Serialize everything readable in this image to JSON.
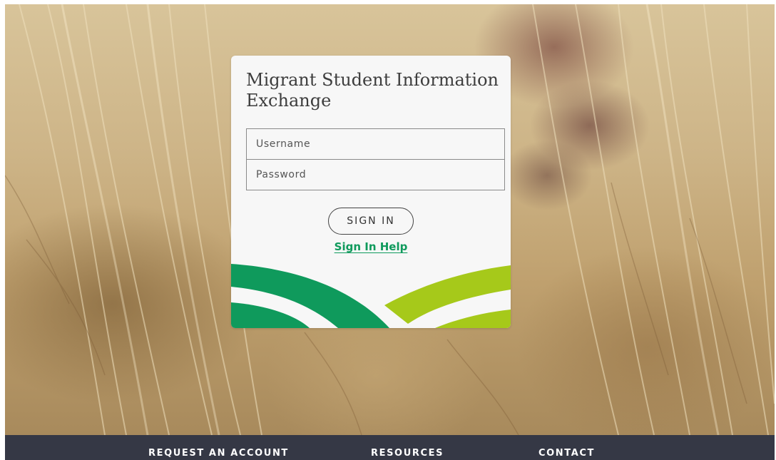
{
  "login": {
    "title": "Migrant Student Information Exchange",
    "username_placeholder": "Username",
    "password_placeholder": "Password",
    "sign_in_label": "SIGN IN",
    "help_link": "Sign In Help"
  },
  "footer": {
    "links": [
      {
        "label": "REQUEST AN ACCOUNT"
      },
      {
        "label": "RESOURCES"
      },
      {
        "label": "CONTACT"
      }
    ]
  },
  "colors": {
    "brand_dark_green": "#0f9a5c",
    "brand_light_green": "#a6c91a",
    "footer_background": "#353845",
    "card_background": "#f7f7f7"
  },
  "background": {
    "icon": "wheat-field-photo"
  }
}
